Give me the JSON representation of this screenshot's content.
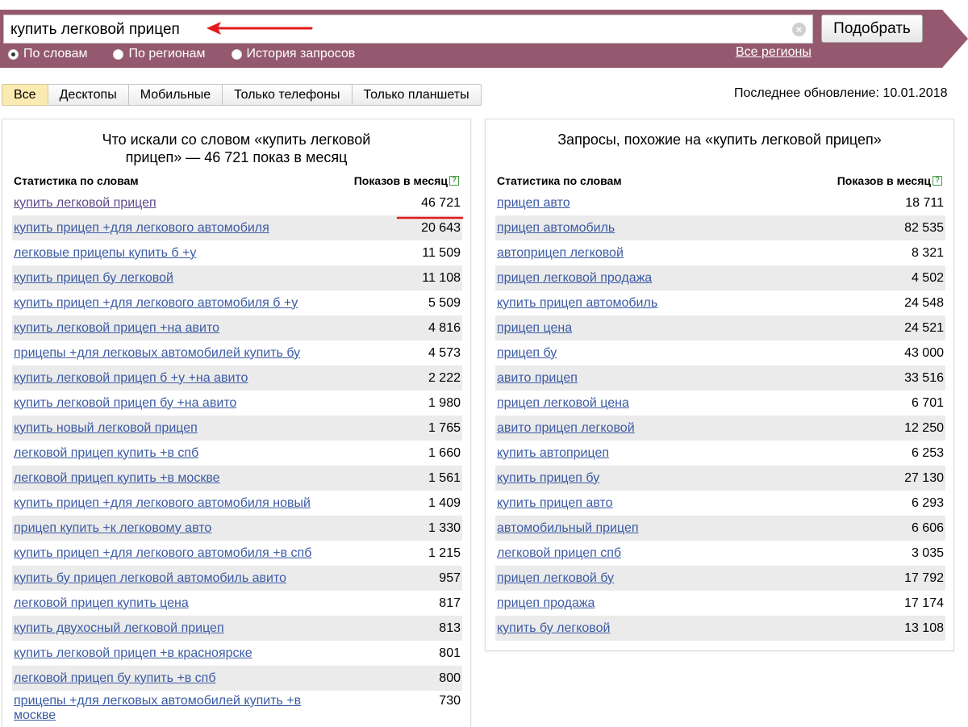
{
  "search": {
    "query": "купить легковой прицеп",
    "submit_label": "Подобрать",
    "clear_icon": "×"
  },
  "colors": {
    "bar_bg": "#94596f",
    "active_tab": "#fbeab2",
    "link": "#3b5aa3",
    "annotation_red": "#e21a1a"
  },
  "modes": [
    {
      "label": "По словам",
      "selected": true
    },
    {
      "label": "По регионам",
      "selected": false
    },
    {
      "label": "История запросов",
      "selected": false
    }
  ],
  "regions_link": "Все регионы",
  "tabs": [
    "Все",
    "Десктопы",
    "Мобильные",
    "Только телефоны",
    "Только планшеты"
  ],
  "update_info": "Последнее обновление: 10.01.2018",
  "left_panel": {
    "title": "Что искали со словом «купить легковой прицеп» — 46 721 показ в месяц",
    "col_phrase": "Статистика по словам",
    "col_count": "Показов в месяц",
    "rows": [
      {
        "phrase": "купить легковой прицеп",
        "count": "46 721"
      },
      {
        "phrase": "купить прицеп +для легкового автомобиля",
        "count": "20 643"
      },
      {
        "phrase": "легковые прицепы купить б +у",
        "count": "11 509"
      },
      {
        "phrase": "купить прицеп бу легковой",
        "count": "11 108"
      },
      {
        "phrase": "купить прицеп +для легкового автомобиля б +у",
        "count": "5 509"
      },
      {
        "phrase": "купить легковой прицеп +на авито",
        "count": "4 816"
      },
      {
        "phrase": "прицепы +для легковых автомобилей купить бу",
        "count": "4 573"
      },
      {
        "phrase": "купить легковой прицеп б +у +на авито",
        "count": "2 222"
      },
      {
        "phrase": "купить легковой прицеп бу +на авито",
        "count": "1 980"
      },
      {
        "phrase": "купить новый легковой прицеп",
        "count": "1 765"
      },
      {
        "phrase": "легковой прицеп купить +в спб",
        "count": "1 660"
      },
      {
        "phrase": "легковой прицеп купить +в москве",
        "count": "1 561"
      },
      {
        "phrase": "купить прицеп +для легкового автомобиля новый",
        "count": "1 409"
      },
      {
        "phrase": "прицеп купить +к легковому авто",
        "count": "1 330"
      },
      {
        "phrase": "купить прицеп +для легкового автомобиля +в спб",
        "count": "1 215"
      },
      {
        "phrase": "купить бу прицеп легковой автомобиль авито",
        "count": "957"
      },
      {
        "phrase": "легковой прицеп купить цена",
        "count": "817"
      },
      {
        "phrase": "купить двухосный легковой прицеп",
        "count": "813"
      },
      {
        "phrase": "купить легковой прицеп +в красноярске",
        "count": "801"
      },
      {
        "phrase": "легковой прицеп бу купить +в спб",
        "count": "800"
      },
      {
        "phrase": "прицепы +для легковых автомобилей купить +в москве",
        "count": "730"
      }
    ]
  },
  "right_panel": {
    "title": "Запросы, похожие на «купить легковой прицеп»",
    "col_phrase": "Статистика по словам",
    "col_count": "Показов в месяц",
    "rows": [
      {
        "phrase": "прицеп авто",
        "count": "18 711"
      },
      {
        "phrase": "прицеп автомобиль",
        "count": "82 535"
      },
      {
        "phrase": "автоприцеп легковой",
        "count": "8 321"
      },
      {
        "phrase": "прицеп легковой продажа",
        "count": "4 502"
      },
      {
        "phrase": "купить прицеп автомобиль",
        "count": "24 548"
      },
      {
        "phrase": "прицеп цена",
        "count": "24 521"
      },
      {
        "phrase": "прицеп бу",
        "count": "43 000"
      },
      {
        "phrase": "авито прицеп",
        "count": "33 516"
      },
      {
        "phrase": "прицеп легковой цена",
        "count": "6 701"
      },
      {
        "phrase": "авито прицеп легковой",
        "count": "12 250"
      },
      {
        "phrase": "купить автоприцеп",
        "count": "6 253"
      },
      {
        "phrase": "купить прицеп бу",
        "count": "27 130"
      },
      {
        "phrase": "купить прицеп авто",
        "count": "6 293"
      },
      {
        "phrase": "автомобильный прицеп",
        "count": "6 606"
      },
      {
        "phrase": "легковой прицеп спб",
        "count": "3 035"
      },
      {
        "phrase": "прицеп легковой бу",
        "count": "17 792"
      },
      {
        "phrase": "прицеп продажа",
        "count": "17 174"
      },
      {
        "phrase": "купить бу легковой",
        "count": "13 108"
      }
    ]
  }
}
